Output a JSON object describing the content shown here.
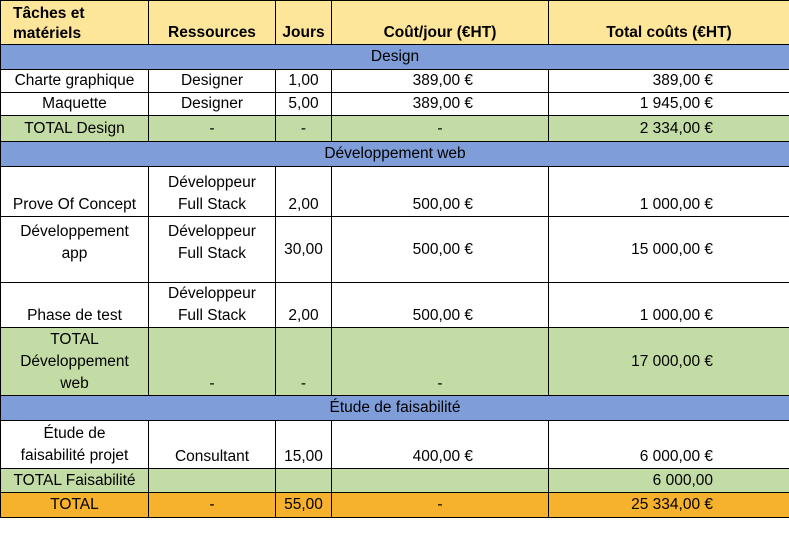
{
  "header": [
    "Tâches et\nmatériels",
    "Ressources",
    "Jours",
    "Coût/jour (€HT)",
    "Total coûts (€HT)"
  ],
  "sections": {
    "design": {
      "title": "Design",
      "rows": [
        [
          "Charte graphique",
          "Designer",
          "1,00",
          "389,00 €",
          "389,00 €"
        ],
        [
          "Maquette",
          "Designer",
          "5,00",
          "389,00 €",
          "1 945,00 €"
        ]
      ],
      "total": [
        "TOTAL Design",
        "-",
        "-",
        "-",
        "2 334,00 €"
      ]
    },
    "dev": {
      "title": "Développement web",
      "rows": [
        [
          "Prove Of Concept",
          "Développeur\nFull Stack",
          "2,00",
          "500,00 €",
          "1 000,00 €"
        ],
        [
          "Développement\napp",
          "Développeur\nFull Stack",
          "30,00",
          "500,00 €",
          "15 000,00 €"
        ],
        [
          "Phase de test",
          "Développeur\nFull Stack",
          "2,00",
          "500,00 €",
          "1 000,00 €"
        ]
      ],
      "total": [
        "TOTAL\nDéveloppement\nweb",
        "-",
        "-",
        "-",
        "17 000,00 €"
      ]
    },
    "feas": {
      "title": "Étude de faisabilité",
      "rows": [
        [
          "Étude de\nfaisabilité projet",
          "Consultant",
          "15,00",
          "400,00 €",
          "6 000,00 €"
        ]
      ],
      "total": [
        "TOTAL Faisabilité",
        "",
        "",
        "",
        "6 000,00"
      ]
    }
  },
  "grand_total": [
    "TOTAL",
    "-",
    "55,00",
    "-",
    "25 334,00 €"
  ],
  "colors": {
    "header": "#fde69a",
    "section": "#7f9ed9",
    "subtotal": "#c3dba4",
    "grand_total": "#f6b12d"
  }
}
